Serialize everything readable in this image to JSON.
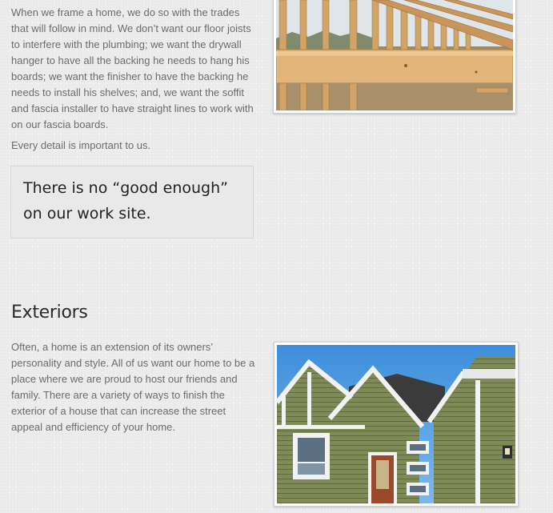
{
  "framing": {
    "paragraph": "When we frame a home, we do so with the trades that will follow in mind. We don’t want our floor joists to interfere with the plumbing; we want the drywall hanger to have all the backing he needs to hang his boards; we want the finisher to have the backing he needs to install his shelves; and, we want the soffit and fascia installer to have straight lines to work with on our fascia boards.",
    "detail_text": "Every detail is important to us.",
    "quote": "There is no “good enough” on our work site."
  },
  "exteriors": {
    "heading": "Exteriors",
    "paragraph": "Often, a home is an extension of its owners’ personality and style. All of us want our home to be a place where we are proud to host our friends and family. There are a variety of ways to finish the exterior of a house that can increase the street appeal and efficiency of your home."
  },
  "images": {
    "framing_photo": "wood-framing-photo",
    "exterior_photo": "house-exterior-photo"
  },
  "colors": {
    "background": "#ececec",
    "quote_background": "#e9e9e9",
    "siding": "#7e8b56",
    "sky": "#4f9be0"
  }
}
